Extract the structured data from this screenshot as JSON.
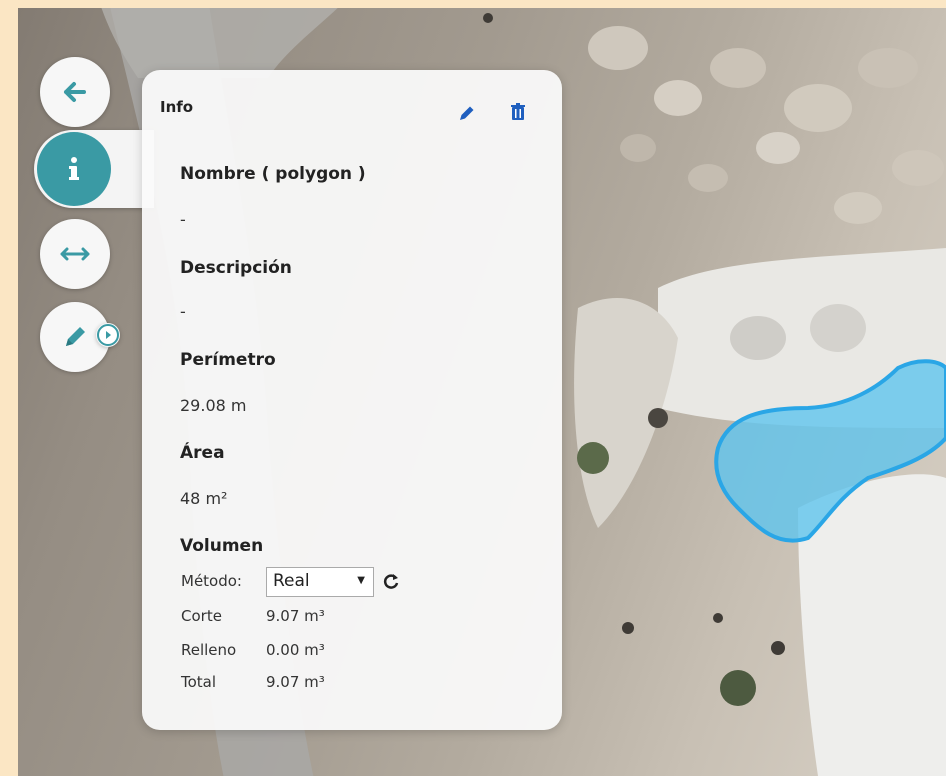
{
  "panel": {
    "title": "Info",
    "name_label": "Nombre ( polygon )",
    "name_value": "-",
    "description_label": "Descripción",
    "description_value": "-",
    "perimeter_label": "Perímetro",
    "perimeter_value": "29.08 m",
    "area_label": "Área",
    "area_value": "48 m²",
    "volume_label": "Volumen",
    "method_label": "Método:",
    "method_selected": "Real",
    "rows": [
      {
        "label": "Corte",
        "value": "9.07 m³"
      },
      {
        "label": "Relleno",
        "value": "0.00 m³"
      },
      {
        "label": "Total",
        "value": "9.07 m³"
      }
    ]
  },
  "icons": {
    "back": "arrow-left-icon",
    "info": "info-icon",
    "measure": "horizontal-arrows-icon",
    "edit": "pencil-icon",
    "expand": "play-circle-icon",
    "header_edit": "pencil-icon",
    "header_delete": "trash-icon",
    "refresh": "refresh-icon"
  },
  "colors": {
    "accent": "#3a9aa4",
    "header_icons": "#1f5fbf",
    "polygon_fill": "#5fc4ee",
    "polygon_stroke": "#2aa6e6",
    "frame": "#fbe6c4"
  }
}
